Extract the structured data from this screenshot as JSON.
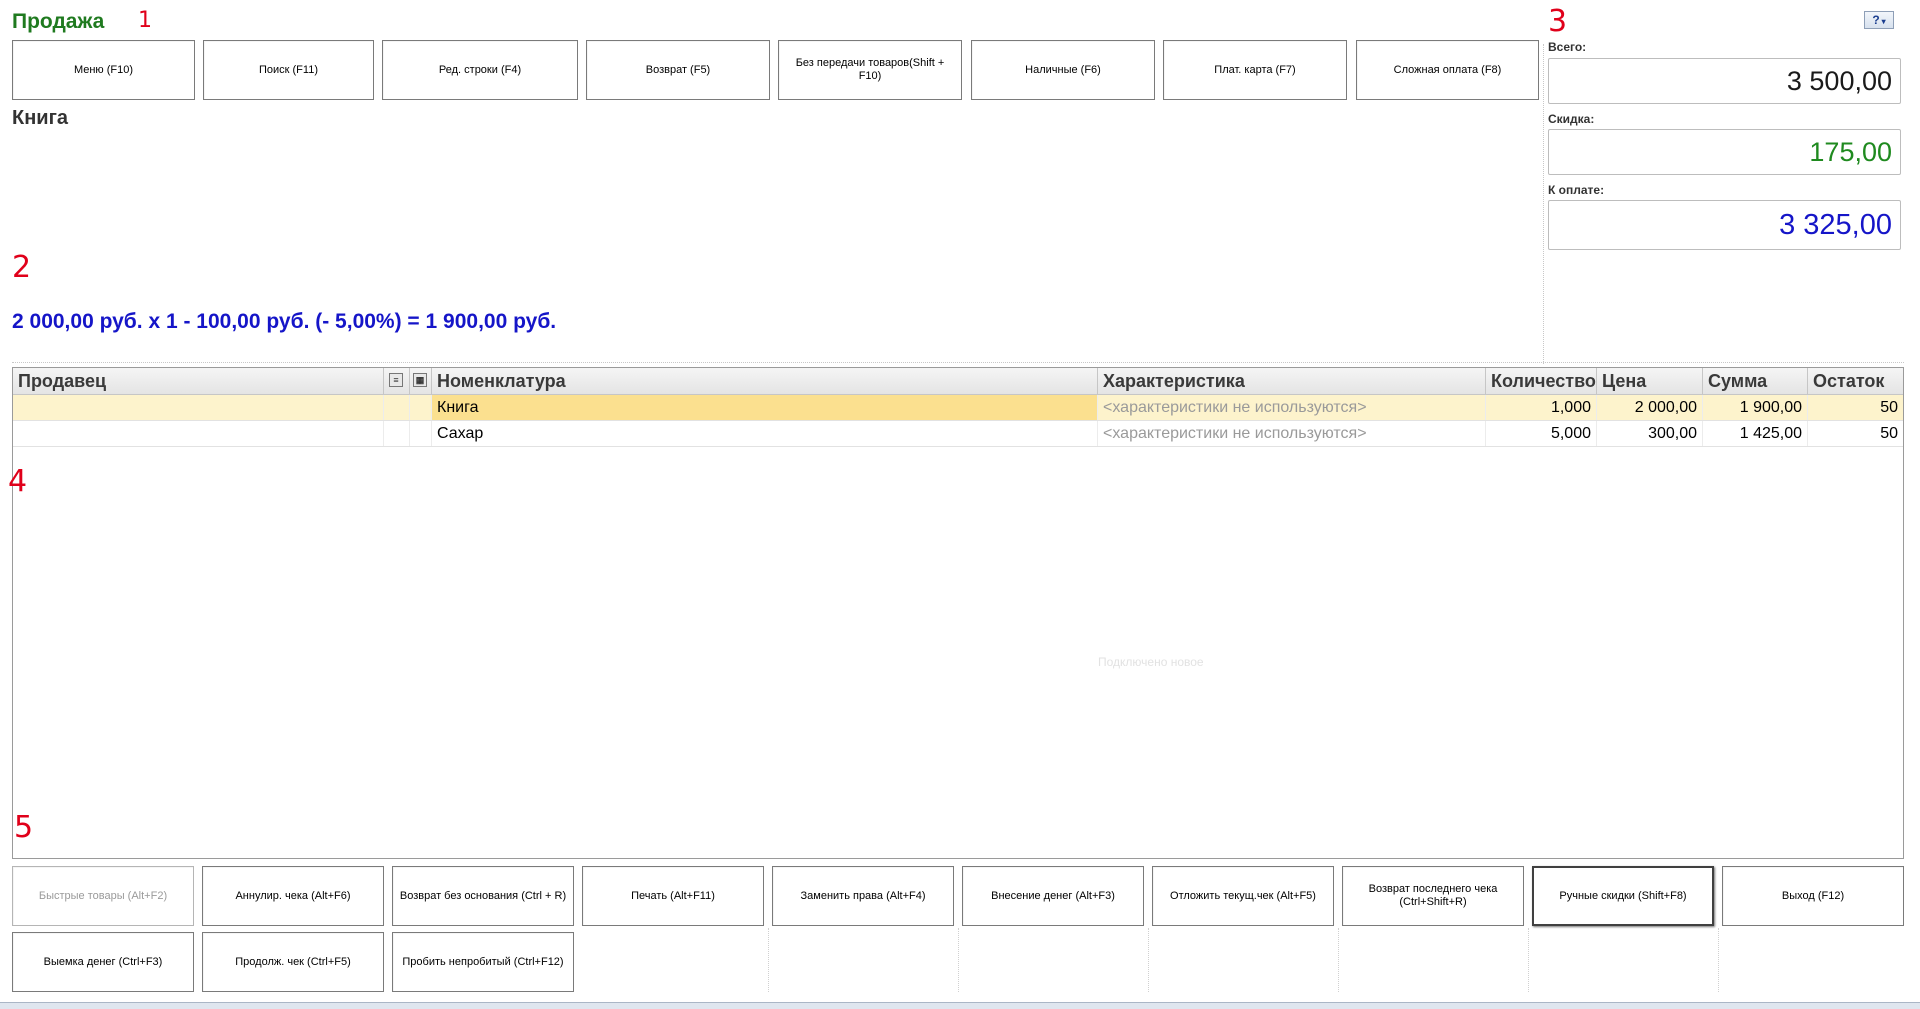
{
  "header": {
    "title": "Продажа",
    "marker_1": "1",
    "marker_3": "3",
    "help_icon": "?"
  },
  "toolbar": {
    "buttons": [
      {
        "label": "Меню (F10)"
      },
      {
        "label": "Поиск (F11)"
      },
      {
        "label": "Ред. строки (F4)"
      },
      {
        "label": "Возврат (F5)"
      },
      {
        "label": "Без передачи товаров(Shift + F10)"
      },
      {
        "label": "Наличные (F6)"
      },
      {
        "label": "Плат. карта (F7)"
      },
      {
        "label": "Сложная оплата (F8)"
      }
    ]
  },
  "current_item": {
    "name": "Книга",
    "marker_2": "2",
    "calculation": "2 000,00 руб. х 1  - 100,00 руб. (- 5,00%) = 1 900,00 руб."
  },
  "totals": {
    "total_label": "Всего:",
    "total_value": "3 500,00",
    "discount_label": "Скидка:",
    "discount_value": "175,00",
    "pay_label": "К оплате:",
    "pay_value": "3 325,00",
    "colors": {
      "total": "#1a1a1a",
      "discount": "#1f8a1f",
      "pay": "#1515c8"
    }
  },
  "grid": {
    "columns": [
      "Продавец",
      "",
      "",
      "Номенклатура",
      "Характеристика",
      "Количество",
      "Цена",
      "Сумма",
      "Остаток"
    ],
    "rows": [
      {
        "seller": "",
        "item": "Книга",
        "characteristic": "<характеристики не используются>",
        "qty": "1,000",
        "price": "2 000,00",
        "sum": "1 900,00",
        "stock": "50"
      },
      {
        "seller": "",
        "item": "Сахар",
        "characteristic": "<характеристики не используются>",
        "qty": "5,000",
        "price": "300,00",
        "sum": "1 425,00",
        "stock": "50"
      }
    ],
    "marker_4": "4",
    "marker_5": "5",
    "watermark": "Подключено новое"
  },
  "bottom_bar": {
    "row1": [
      {
        "label": "Быстрые товары (Alt+F2)"
      },
      {
        "label": "Аннулир. чека (Alt+F6)"
      },
      {
        "label": "Возврат без основания (Ctrl + R)"
      },
      {
        "label": "Печать (Alt+F11)"
      },
      {
        "label": "Заменить права (Alt+F4)"
      },
      {
        "label": "Внесение денег (Alt+F3)"
      },
      {
        "label": "Отложить текущ.чек (Alt+F5)"
      },
      {
        "label": "Возврат последнего чека (Ctrl+Shift+R)"
      },
      {
        "label": "Ручные скидки (Shift+F8)"
      },
      {
        "label": "Выход (F12)"
      }
    ],
    "row2": [
      {
        "label": "Выемка денег (Ctrl+F3)"
      },
      {
        "label": "Продолж. чек (Ctrl+F5)"
      },
      {
        "label": "Пробить непробитый (Ctrl+F12)"
      }
    ]
  }
}
